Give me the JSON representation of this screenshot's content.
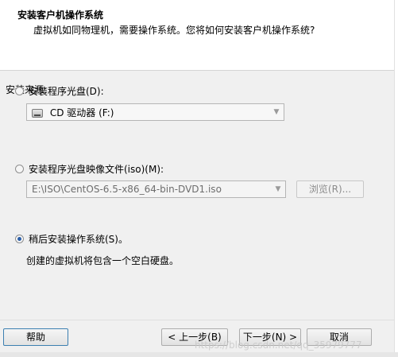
{
  "header": {
    "title": "安装客户机操作系统",
    "subtitle": "虚拟机如同物理机，需要操作系统。您将如何安装客户机操作系统?"
  },
  "install_source": {
    "label": "安装来源:",
    "options": [
      {
        "label": "安装程序光盘(D):",
        "selected": false,
        "combo_value": "CD 驱动器 (F:)"
      },
      {
        "label": "安装程序光盘映像文件(iso)(M):",
        "selected": false,
        "combo_value": "E:\\ISO\\CentOS-6.5-x86_64-bin-DVD1.iso",
        "browse_label": "浏览(R)..."
      },
      {
        "label": "稍后安装操作系统(S)。",
        "selected": true,
        "description": "创建的虚拟机将包含一个空白硬盘。"
      }
    ]
  },
  "footer": {
    "help": "帮助",
    "back": "< 上一步(B)",
    "next": "下一步(N) >",
    "cancel": "取消"
  },
  "watermark": "https://blog.csdn.net/qq_35979777"
}
